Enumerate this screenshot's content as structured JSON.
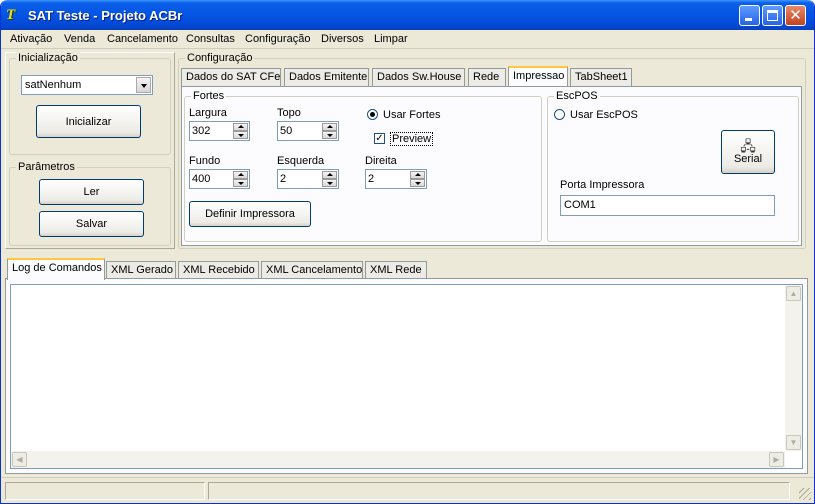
{
  "window": {
    "title": "SAT Teste - Projeto ACBr"
  },
  "menu": [
    "Ativação",
    "Venda",
    "Cancelamento",
    "Consultas",
    "Configuração",
    "Diversos",
    "Limpar"
  ],
  "inicializacao": {
    "legend": "Inicialização",
    "model_value": "satNenhum",
    "init_button": "Inicializar"
  },
  "parametros": {
    "legend": "Parâmetros",
    "read_button": "Ler",
    "save_button": "Salvar"
  },
  "configuracao": {
    "legend": "Configuração",
    "tabs": [
      "Dados do SAT CFe",
      "Dados Emitente",
      "Dados Sw.House",
      "Rede",
      "Impressao",
      "TabSheet1"
    ],
    "active_tab": "Impressao"
  },
  "fortes": {
    "legend": "Fortes",
    "largura_label": "Largura",
    "largura_value": "302",
    "topo_label": "Topo",
    "topo_value": "50",
    "fundo_label": "Fundo",
    "fundo_value": "400",
    "esquerda_label": "Esquerda",
    "esquerda_value": "2",
    "direita_label": "Direita",
    "direita_value": "2",
    "usar_fortes_label": "Usar Fortes",
    "usar_fortes_selected": true,
    "preview_label": "Preview",
    "preview_checked": true,
    "definir_button": "Definir Impressora"
  },
  "escpos": {
    "legend": "EscPOS",
    "usar_escpos_label": "Usar EscPOS",
    "usar_escpos_selected": false,
    "serial_button": "Serial",
    "porta_label": "Porta Impressora",
    "porta_value": "COM1"
  },
  "bottom_tabs": [
    "Log de Comandos",
    "XML Gerado",
    "XML Recebido",
    "XML Cancelamento",
    "XML Rede"
  ],
  "bottom_active_tab": "Log de Comandos",
  "colors": {
    "title_blue": "#0554e3",
    "face": "#ece9d8",
    "tab_highlight": "#ffc83c"
  }
}
